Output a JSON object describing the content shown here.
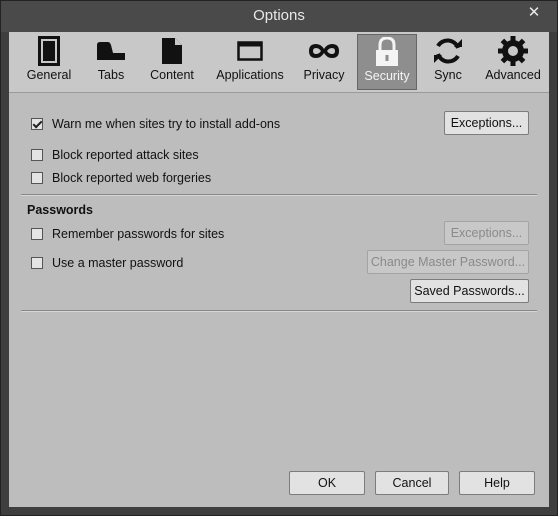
{
  "window": {
    "title": "Options",
    "close_label": "✕"
  },
  "toolbar": {
    "tabs": [
      {
        "label": "General",
        "icon": "general-icon"
      },
      {
        "label": "Tabs",
        "icon": "tabs-icon"
      },
      {
        "label": "Content",
        "icon": "content-icon"
      },
      {
        "label": "Applications",
        "icon": "applications-icon"
      },
      {
        "label": "Privacy",
        "icon": "privacy-icon"
      },
      {
        "label": "Security",
        "icon": "lock-icon",
        "active": true
      },
      {
        "label": "Sync",
        "icon": "sync-icon"
      },
      {
        "label": "Advanced",
        "icon": "gear-icon"
      }
    ]
  },
  "security": {
    "warn_addons": {
      "label": "Warn me when sites try to install add-ons",
      "checked": true
    },
    "exceptions_label": "Exceptions...",
    "block_attack": {
      "label": "Block reported attack sites",
      "checked": false
    },
    "block_forgeries": {
      "label": "Block reported web forgeries",
      "checked": false
    },
    "passwords_title": "Passwords",
    "remember_passwords": {
      "label": "Remember passwords for sites",
      "checked": false
    },
    "password_exceptions_label": "Exceptions...",
    "master_password": {
      "label": "Use a master password",
      "checked": false
    },
    "change_master_label": "Change Master Password...",
    "saved_passwords_label": "Saved Passwords..."
  },
  "footer": {
    "ok_label": "OK",
    "cancel_label": "Cancel",
    "help_label": "Help"
  }
}
